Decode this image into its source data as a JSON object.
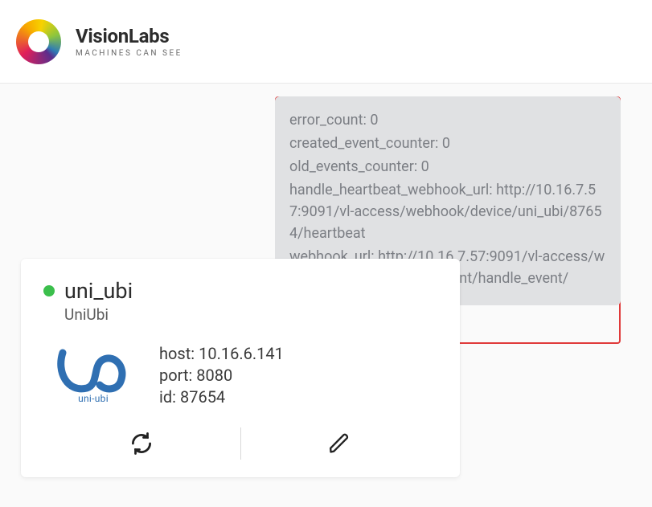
{
  "brand": {
    "title": "VisionLabs",
    "tagline": "MACHINES CAN SEE"
  },
  "tooltip": {
    "error_count_label": "error_count:",
    "error_count_value": "0",
    "created_event_counter_label": "created_event_counter:",
    "created_event_counter_value": "0",
    "old_events_counter_label": "old_events_counter:",
    "old_events_counter_value": "0",
    "heartbeat_label": "handle_heartbeat_webhook_url:",
    "heartbeat_url": "http://10.16.7.57:9091/vl-access/webhook/device/uni_ubi/87654/heartbeat",
    "webhook_label": "webhook_url:",
    "webhook_url": "http://10.16.7.57:9091/vl-access/webhook/device/87654/event/handle_event/"
  },
  "card": {
    "title": "uni_ubi",
    "subtitle": "UniUbi",
    "vendor_caption": "uni-ubi",
    "host_label": "host:",
    "host_value": "10.16.6.141",
    "port_label": "port:",
    "port_value": "8080",
    "id_label": "id:",
    "id_value": "87654"
  }
}
